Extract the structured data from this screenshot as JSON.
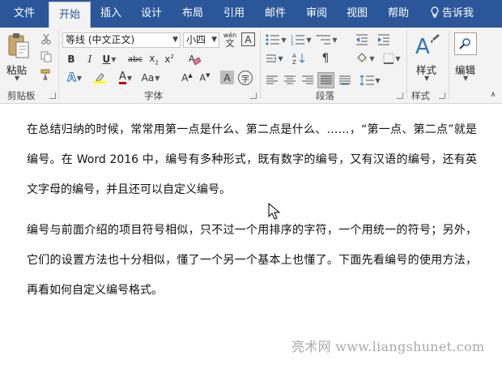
{
  "tabs": [
    {
      "label": "文件"
    },
    {
      "label": "开始"
    },
    {
      "label": "插入"
    },
    {
      "label": "设计"
    },
    {
      "label": "布局"
    },
    {
      "label": "引用"
    },
    {
      "label": "邮件"
    },
    {
      "label": "审阅"
    },
    {
      "label": "视图"
    },
    {
      "label": "帮助"
    }
  ],
  "tell_me": "告诉我",
  "ribbon": {
    "clipboard": {
      "paste_label": "粘贴",
      "group_label": "剪贴板"
    },
    "font": {
      "font_name": "等线 (中文正文)",
      "font_size": "小四",
      "wen_glyph": "wén",
      "group_label": "字体",
      "buttons": {
        "bold": "B",
        "italic": "I",
        "underline": "U",
        "strike": "abc",
        "subscript": "x",
        "superscript": "x",
        "grow": "A",
        "shrink": "A",
        "aa": "Aa",
        "char_shade": "A",
        "encircle": "字"
      }
    },
    "paragraph": {
      "group_label": "段落"
    },
    "styles": {
      "label": "样式",
      "group_label": "样式"
    },
    "editing": {
      "label": "编辑"
    }
  },
  "document": {
    "paragraphs": [
      "在总结归纳的时候，常常用第一点是什么、第二点是什么、……，“第一点、第二点”就是编号。在 Word 2016 中，编号有多种形式，既有数字的编号，又有汉语的编号，还有英文字母的编号，并且还可以自定义编号。",
      "编号与前面介绍的项目符号相似，只不过一个用排序的字符，一个用统一的符号；另外，它们的设置方法也十分相似，懂了一个另一个基本上也懂了。下面先看编号的使用方法，再看如何自定义编号格式。"
    ]
  },
  "watermark": "亮术网 www.liangshunet.com",
  "colors": {
    "tab_bar": "#2b579a",
    "ribbon_bg": "#f3f3f3",
    "highlight": "#ffff00",
    "font_color": "#c00000"
  }
}
